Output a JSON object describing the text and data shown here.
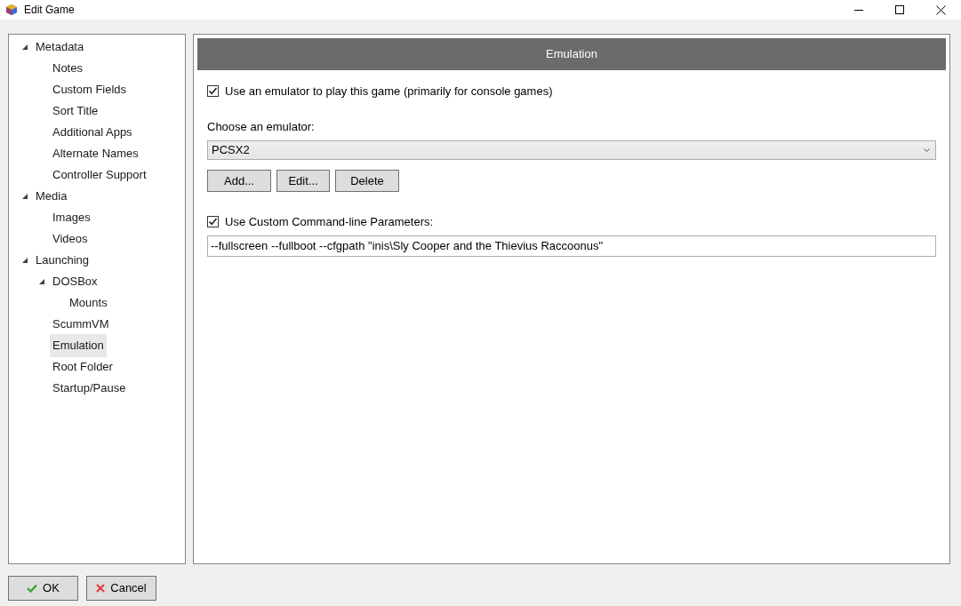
{
  "window": {
    "title": "Edit Game"
  },
  "tree": [
    {
      "label": "Metadata",
      "expanded": true,
      "selected": false,
      "children": [
        {
          "label": "Notes",
          "selected": false
        },
        {
          "label": "Custom Fields",
          "selected": false
        },
        {
          "label": "Sort Title",
          "selected": false
        },
        {
          "label": "Additional Apps",
          "selected": false
        },
        {
          "label": "Alternate Names",
          "selected": false
        },
        {
          "label": "Controller Support",
          "selected": false
        }
      ]
    },
    {
      "label": "Media",
      "expanded": true,
      "selected": false,
      "children": [
        {
          "label": "Images",
          "selected": false
        },
        {
          "label": "Videos",
          "selected": false
        }
      ]
    },
    {
      "label": "Launching",
      "expanded": true,
      "selected": false,
      "children": [
        {
          "label": "DOSBox",
          "expanded": true,
          "selected": false,
          "children": [
            {
              "label": "Mounts",
              "selected": false
            }
          ]
        },
        {
          "label": "ScummVM",
          "selected": false
        },
        {
          "label": "Emulation",
          "selected": true
        },
        {
          "label": "Root Folder",
          "selected": false
        },
        {
          "label": "Startup/Pause",
          "selected": false
        }
      ]
    }
  ],
  "panel": {
    "header": "Emulation",
    "use_emulator": {
      "label": "Use an emulator to play this game (primarily for console games)",
      "checked": true
    },
    "emulator_label": "Choose an emulator:",
    "emulator_value": "PCSX2",
    "buttons": [
      "Add...",
      "Edit...",
      "Delete"
    ],
    "custom_params": {
      "label": "Use Custom Command-line Parameters:",
      "checked": true
    },
    "params_value": "--fullscreen --fullboot --cfgpath \"inis\\Sly Cooper and the Thievius Raccoonus\""
  },
  "footer_buttons": [
    {
      "kind": "ok",
      "label": "OK"
    },
    {
      "kind": "cancel",
      "label": "Cancel"
    }
  ]
}
